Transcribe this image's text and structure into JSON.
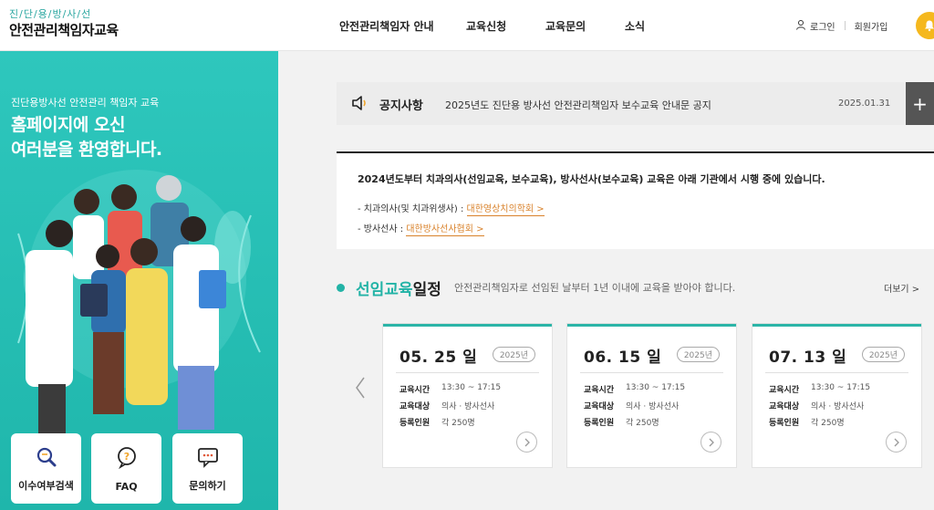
{
  "header": {
    "logo_top": "진/단/용/방/사/선",
    "logo_main": "안전관리책임자교육",
    "nav": [
      "안전관리책임자 안내",
      "교육신청",
      "교육문의",
      "소식"
    ],
    "login": "로그인",
    "signup": "회원가입"
  },
  "hero": {
    "subtitle": "진단용방사선 안전관리 책임자 교육",
    "title_line1": "홈페이지에 오신",
    "title_line2": "여러분을 환영합니다.",
    "quick_links": [
      "이수여부검색",
      "FAQ",
      "문의하기"
    ]
  },
  "notice": {
    "title": "공지사항",
    "text": "2025년도 진단용 방사선 안전관리책임자 보수교육 안내문 공지",
    "date": "2025.01.31",
    "more": "+"
  },
  "info": {
    "headline": "2024년도부터 치과의사(선임교육, 보수교육), 방사선사(보수교육) 교육은 아래 기관에서 시행 중에 있습니다.",
    "rows": [
      {
        "label": "- 치과의사(및 치과위생사) : ",
        "link": "대한영상치의학회 >"
      },
      {
        "label": "- 방사선사 : ",
        "link": "대한방사선사협회 >"
      }
    ]
  },
  "schedule": {
    "title_highlight": "선임교육",
    "title_rest": "일정",
    "description": "안전관리책임자로 선임된 날부터 1년 이내에 교육을 받아야 합니다.",
    "more": "더보기 >",
    "labels": {
      "time": "교육시간",
      "target": "교육대상",
      "capacity": "등록인원"
    },
    "cards": [
      {
        "date": "05. 25 일",
        "year": "2025년",
        "time": "13:30 ~ 17:15",
        "target": "의사 · 방사선사",
        "capacity": "각 250명"
      },
      {
        "date": "06. 15 일",
        "year": "2025년",
        "time": "13:30 ~ 17:15",
        "target": "의사 · 방사선사",
        "capacity": "각 250명"
      },
      {
        "date": "07. 13 일",
        "year": "2025년",
        "time": "13:30 ~ 17:15",
        "target": "의사 · 방사선사",
        "capacity": "각 250명"
      }
    ]
  },
  "colors": {
    "teal": "#22b3a6",
    "accent_orange": "#d9822b",
    "bell": "#f5b81e"
  },
  "icons": [
    "user-icon",
    "bell-icon",
    "speaker-icon",
    "search-doc-icon",
    "faq-bubble-icon",
    "chat-icon",
    "chevron-left-icon",
    "chevron-right-icon"
  ]
}
